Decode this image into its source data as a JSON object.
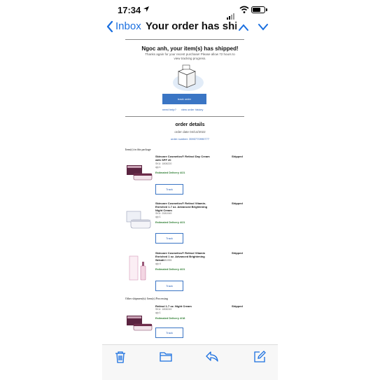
{
  "status": {
    "time": "17:34"
  },
  "nav": {
    "back_label": "Inbox",
    "subject": "Your order has shipped!"
  },
  "email": {
    "greeting": "Ngoc anh, your item(s) has shipped!",
    "thanks": "Thanks again for your recent purchase! Please allow 72 hours to view tracking progress.",
    "track_order_label": "track order",
    "need_help": "need help?",
    "view_history": "view order history",
    "details_title": "order details",
    "order_date": "order date 04/14/2022",
    "order_number": "order number: 3593770990777",
    "package_label": "Item(s) in this package",
    "other_label": "Other shipment(s): Item(s) Processing",
    "items": [
      {
        "name": "Skincare Cosmetics® Retinol Day Cream with SPF 20",
        "sku": "SKU: 1808220",
        "qty": "qty:1",
        "est": "Estimated Delivery 4/21",
        "status": "Shipped",
        "track": "Track"
      },
      {
        "name": "Skincare Cosmetics® Retinol Vitamin-Enriched 1.7 oz. Advanced Brightening Night Cream",
        "sku": "SKU: 2081949",
        "qty": "qty:1",
        "est": "Estimated Delivery 4/21",
        "status": "Shipped",
        "track": "Track"
      },
      {
        "name": "Skincare Cosmetics® Retinol Vitamin Enriched 1 oz. Advanced Brightening Serum",
        "sku": "SKU: 2081955",
        "qty": "qty:4",
        "est": "Estimated Delivery 4/21",
        "status": "Shipped",
        "track": "Track"
      },
      {
        "name": "Retinol 1.7 oz. Night Cream",
        "sku": "SKU: 1808249",
        "qty": "qty:1",
        "est": "Estimated Delivery 4/18",
        "status": "Shipped",
        "track": "Track"
      }
    ]
  },
  "colors": {
    "accent": "#1a6fe0",
    "button": "#3a75c4",
    "delivery": "#2e7d32"
  },
  "toolbar": {
    "icons": [
      "trash-icon",
      "folder-icon",
      "reply-icon",
      "compose-icon"
    ]
  }
}
